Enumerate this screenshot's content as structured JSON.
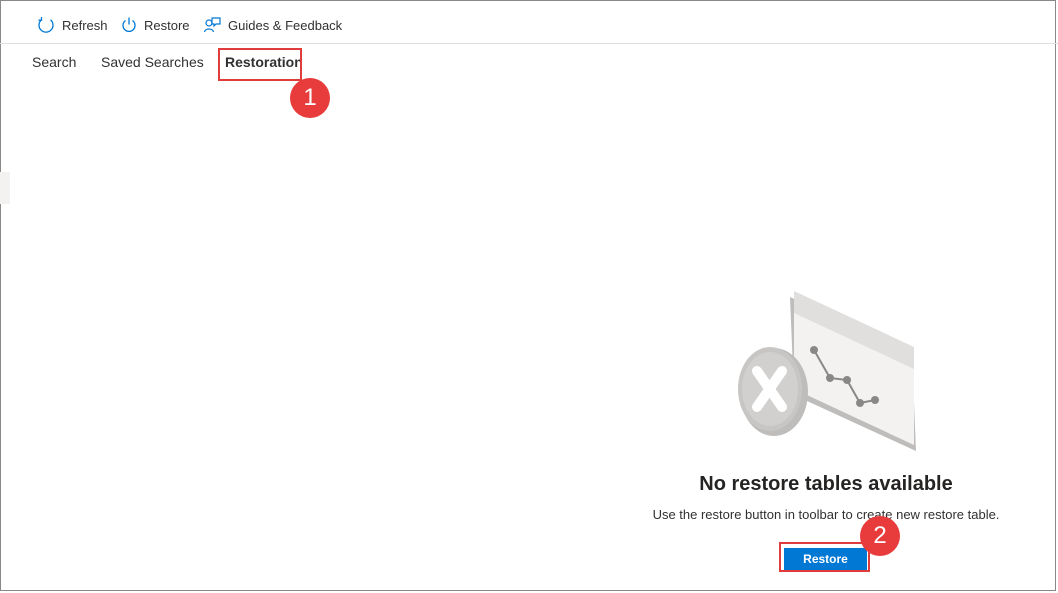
{
  "toolbar": {
    "refresh_label": "Refresh",
    "restore_label": "Restore",
    "guides_label": "Guides & Feedback"
  },
  "tabs": [
    {
      "label": "Search"
    },
    {
      "label": "Saved Searches"
    },
    {
      "label": "Restoration",
      "active": true
    }
  ],
  "empty_state": {
    "title": "No restore tables available",
    "description": "Use the restore button in toolbar to create new restore table.",
    "button_label": "Restore"
  },
  "callouts": [
    {
      "number": "1"
    },
    {
      "number": "2"
    }
  ],
  "colors": {
    "accent": "#0078d4",
    "callout": "#e83b3b"
  },
  "icons": [
    "refresh-icon",
    "power-icon",
    "feedback-icon"
  ]
}
